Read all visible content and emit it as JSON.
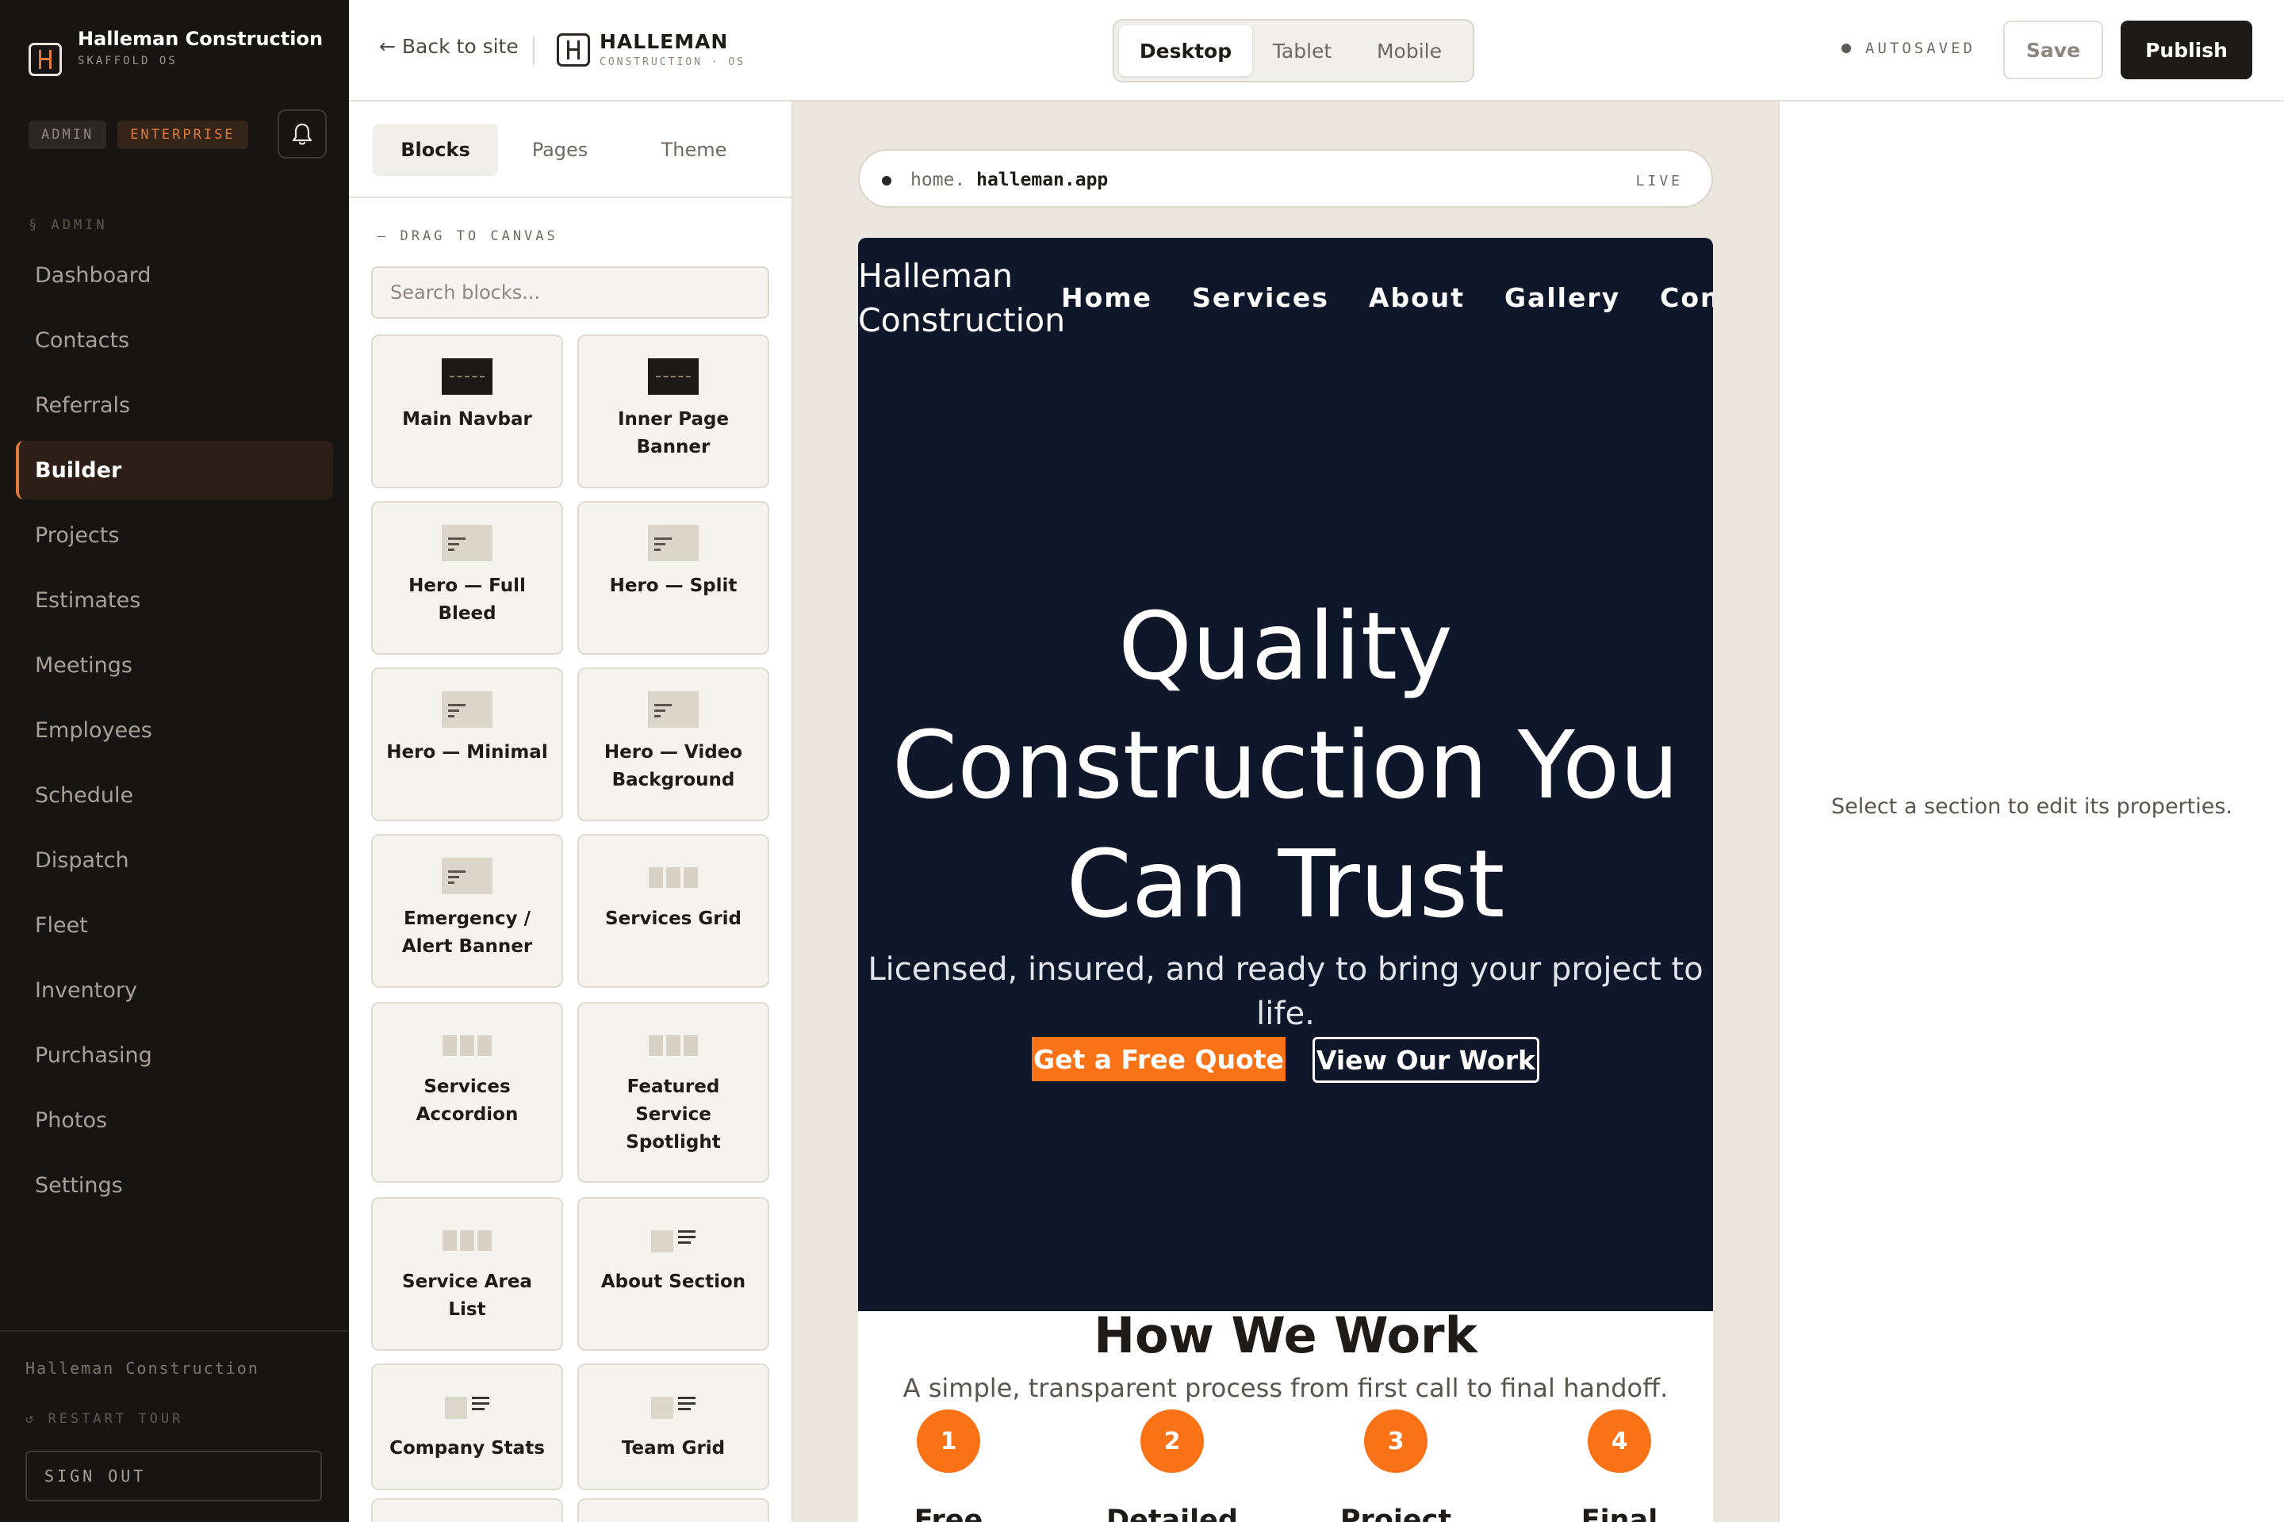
{
  "sidebar": {
    "brand_name": "Halleman Construction",
    "brand_sub": "SKAFFOLD OS",
    "badge_admin": "ADMIN",
    "badge_enterprise": "ENTERPRISE",
    "section_label": "§ ADMIN",
    "items": [
      {
        "label": "Dashboard"
      },
      {
        "label": "Contacts"
      },
      {
        "label": "Referrals"
      },
      {
        "label": "Builder",
        "active": true
      },
      {
        "label": "Projects"
      },
      {
        "label": "Estimates"
      },
      {
        "label": "Meetings"
      },
      {
        "label": "Employees"
      },
      {
        "label": "Schedule"
      },
      {
        "label": "Dispatch"
      },
      {
        "label": "Fleet"
      },
      {
        "label": "Inventory"
      },
      {
        "label": "Purchasing"
      },
      {
        "label": "Photos"
      },
      {
        "label": "Settings"
      }
    ],
    "footer_company": "Halleman Construction",
    "restart_tour": "↺ RESTART TOUR",
    "sign_out": "SIGN OUT"
  },
  "topbar": {
    "back_link": "← Back to site",
    "brand_name": "HALLEMAN",
    "brand_sub": "CONSTRUCTION · OS",
    "devices": [
      "Desktop",
      "Tablet",
      "Mobile"
    ],
    "selected_device": "Desktop",
    "autosave": "AUTOSAVED",
    "save": "Save",
    "publish": "Publish"
  },
  "panel": {
    "tabs": [
      "Blocks",
      "Pages",
      "Theme"
    ],
    "selected_tab": "Blocks",
    "drag_label": "— DRAG TO CANVAS",
    "search_placeholder": "Search blocks...",
    "blocks": [
      {
        "name": "Main Navbar",
        "icon": "navbar-thumb-icon"
      },
      {
        "name": "Inner Page Banner",
        "icon": "navbar-thumb-icon"
      },
      {
        "name": "Hero — Full Bleed",
        "icon": "hero-thumb-icon"
      },
      {
        "name": "Hero — Split",
        "icon": "hero-thumb-icon"
      },
      {
        "name": "Hero — Minimal",
        "icon": "hero-thumb-icon"
      },
      {
        "name": "Hero — Video Background",
        "icon": "hero-thumb-icon"
      },
      {
        "name": "Emergency / Alert Banner",
        "icon": "hero-thumb-icon"
      },
      {
        "name": "Services Grid",
        "icon": "grid-thumb-icon"
      },
      {
        "name": "Services Accordion",
        "icon": "grid-thumb-icon"
      },
      {
        "name": "Featured Service Spotlight",
        "icon": "grid-thumb-icon"
      },
      {
        "name": "Service Area List",
        "icon": "grid-thumb-icon"
      },
      {
        "name": "About Section",
        "icon": "about-thumb-icon"
      },
      {
        "name": "Company Stats",
        "icon": "about-thumb-icon"
      },
      {
        "name": "Team Grid",
        "icon": "about-thumb-icon"
      }
    ]
  },
  "canvas": {
    "url_prefix": "home.",
    "url_domain": "halleman.app",
    "url_status": "LIVE",
    "site": {
      "brand": "Halleman Construction",
      "nav": [
        "Home",
        "Services",
        "About",
        "Gallery",
        "Contact"
      ],
      "hero_title": "Quality Construction You Can Trust",
      "hero_subtitle": "Licensed, insured, and ready to bring your project to life.",
      "cta_primary": "Get a Free Quote",
      "cta_secondary": "View Our Work",
      "how_title": "How We Work",
      "how_subtitle": "A simple, transparent process from first call to final handoff.",
      "steps": [
        {
          "num": "1",
          "label": "Free"
        },
        {
          "num": "2",
          "label": "Detailed"
        },
        {
          "num": "3",
          "label": "Project"
        },
        {
          "num": "4",
          "label": "Final"
        }
      ]
    }
  },
  "properties": {
    "empty_text": "Select a section to edit its properties."
  },
  "colors": {
    "accent": "#e07a3a",
    "cta_orange": "#f97316",
    "hero_navy": "#0f172a",
    "sidebar_bg": "#171513"
  }
}
